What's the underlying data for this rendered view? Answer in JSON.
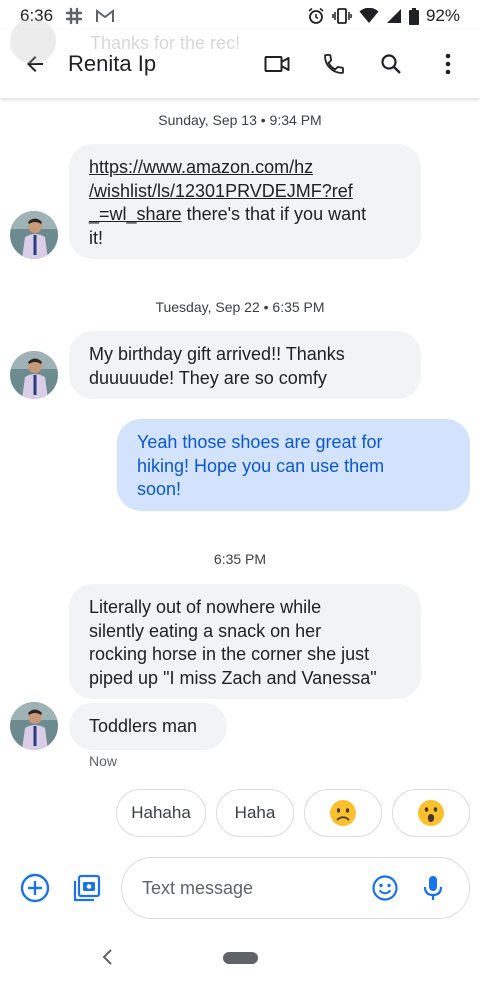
{
  "status_bar": {
    "time": "6:36",
    "battery": "92%",
    "icons": [
      "slack-icon",
      "gmail-icon",
      "alarm-icon",
      "vibrate-icon",
      "wifi-icon",
      "signal-icon",
      "battery-icon"
    ]
  },
  "notification_ghost": {
    "text": "Thanks for the rec!"
  },
  "header": {
    "contact_name": "Renita Ip",
    "actions": [
      "video-call-icon",
      "phone-icon",
      "search-icon",
      "more-vert-icon"
    ]
  },
  "conversation": {
    "day1": "Sunday, Sep 13 • 9:34 PM",
    "msg1_link_line1": "https://www.amazon.com/hz",
    "msg1_link_line2": "/wishlist/ls/12301PRVDEJMF?ref",
    "msg1_link_line3": "_=wl_share",
    "msg1_rest_line3": " there's that if you want",
    "msg1_rest_line4": "it!",
    "day2": "Tuesday, Sep 22 • 6:35 PM",
    "msg2_line1": "My birthday gift arrived!! Thanks",
    "msg2_line2": "duuuuude! They are so comfy",
    "msg3_line1": "Yeah those shoes are great for",
    "msg3_line2": "hiking! Hope you can use them",
    "msg3_line3": "soon!",
    "time3": "6:35 PM",
    "msg4_line1": "Literally out of nowhere while",
    "msg4_line2": "silently eating a snack on her",
    "msg4_line3": "rocking horse in the corner she just",
    "msg4_line4": "piped up \"I miss Zach and Vanessa\"",
    "msg5": "Toddlers man",
    "msg5_status": "Now"
  },
  "suggestions": [
    "Hahaha",
    "Haha",
    "worried-face-emoji",
    "surprised-face-emoji"
  ],
  "compose": {
    "placeholder": "Text message"
  },
  "colors": {
    "accent": "#1a73e8",
    "incoming_bubble": "#f1f3f4",
    "outgoing_bubble": "#d3e3fd",
    "outgoing_text": "#0b57d0"
  }
}
